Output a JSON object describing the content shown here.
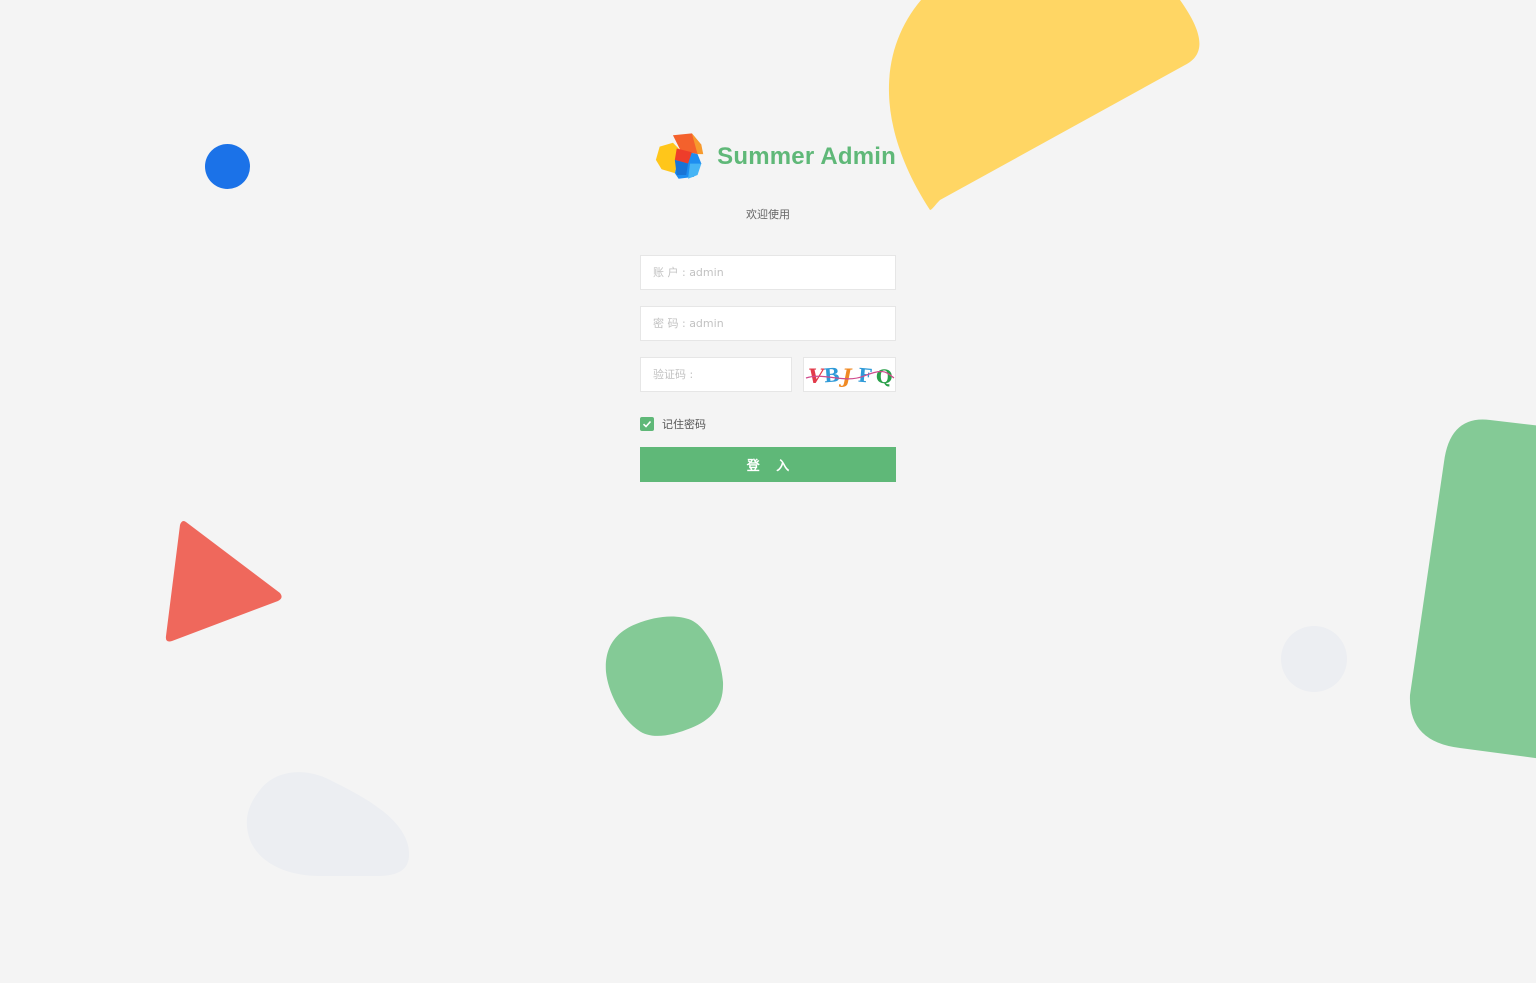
{
  "brand": {
    "name": "Summer Admin",
    "logo_icon": "colorful-cube-icon"
  },
  "welcome_text": "欢迎使用",
  "form": {
    "username_placeholder": "账 户 : admin",
    "password_placeholder": "密 码 : admin",
    "captcha_placeholder": "验证码 :",
    "captcha_text": "VBJFQ",
    "remember_label": "记住密码",
    "remember_checked": true,
    "login_label": "登 入"
  },
  "colors": {
    "accent": "#5fb878",
    "background": "#f4f4f4",
    "blue": "#1b72e8",
    "yellow": "#ffd664",
    "red": "#ef685c",
    "green": "#84ca96"
  }
}
